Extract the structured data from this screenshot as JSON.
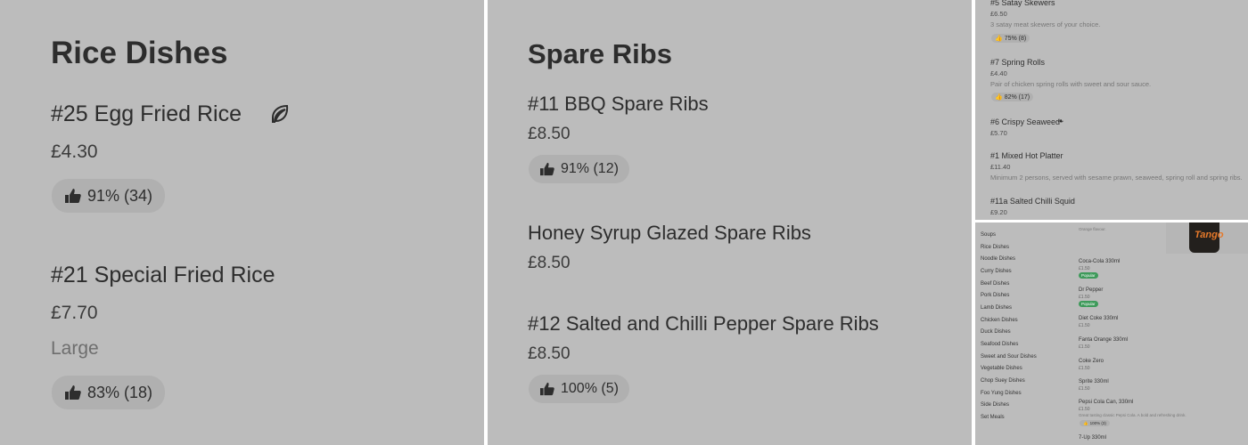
{
  "panel1": {
    "heading": "Rice Dishes",
    "items": [
      {
        "name": "#25 Egg Fried Rice",
        "price": "£4.30",
        "rating": "91% (34)",
        "vegetarian": true
      },
      {
        "name": "#21 Special Fried Rice",
        "price": "£7.70",
        "size": "Large",
        "rating": "83% (18)"
      }
    ]
  },
  "panel2": {
    "heading": "Spare Ribs",
    "items": [
      {
        "name": "#11 BBQ Spare Ribs",
        "price": "£8.50",
        "rating": "91% (12)"
      },
      {
        "name": "Honey Syrup Glazed Spare Ribs",
        "price": "£8.50"
      },
      {
        "name": "#12 Salted and Chilli Pepper Spare Ribs",
        "price": "£8.50",
        "rating": "100% (5)"
      }
    ]
  },
  "panel3": {
    "items": [
      {
        "name": "#5 Satay Skewers",
        "price": "£6.50",
        "desc": "3 satay meat skewers of your choice.",
        "rating": "75% (8)"
      },
      {
        "name": "#7 Spring Rolls",
        "price": "£4.40",
        "desc": "Pair of chicken spring rolls with sweet and sour sauce.",
        "rating": "82% (17)"
      },
      {
        "name": "#6 Crispy Seaweed",
        "price": "£5.70",
        "vegetarian": true
      },
      {
        "name": "#1 Mixed Hot Platter",
        "price": "£11.40",
        "desc": "Minimum 2 persons, served with sesame prawn, seaweed, spring roll and spring ribs."
      },
      {
        "name": "#11a Salted Chilli Squid",
        "price": "£9.20"
      }
    ]
  },
  "panel4": {
    "categories": [
      "Soups",
      "Rice Dishes",
      "Noodle Dishes",
      "Curry Dishes",
      "Beef Dishes",
      "Pork Dishes",
      "Lamb Dishes",
      "Chicken Dishes",
      "Duck Dishes",
      "Seafood Dishes",
      "Sweet and Sour Dishes",
      "Vegetable Dishes",
      "Chop Suey Dishes",
      "Foo Yung Dishes",
      "Side Dishes",
      "Set Meals"
    ],
    "top_desc": "Orange flavour.",
    "product_brand": "Tango",
    "drinks": [
      {
        "name": "Coca-Cola 330ml",
        "price": "£1.50",
        "badge": "Popular"
      },
      {
        "name": "Dr Pepper",
        "price": "£1.50",
        "badge": "Popular"
      },
      {
        "name": "Diet Coke 330ml",
        "price": "£1.50"
      },
      {
        "name": "Fanta Orange 330ml",
        "price": "£1.50"
      },
      {
        "name": "Coke Zero",
        "price": "£1.50"
      },
      {
        "name": "Sprite 330ml",
        "price": "£1.50"
      },
      {
        "name": "Pepsi Cola Can, 330ml",
        "price": "£1.50",
        "desc": "Great tasting classic Pepsi Cola. A bold and refreshing drink.",
        "rating": "100% (3)"
      },
      {
        "name": "7-Up 330ml"
      }
    ]
  },
  "icons": {
    "thumb": "thumbs-up-icon",
    "leaf": "leaf-icon"
  },
  "colors": {
    "background": "#bcbcbc",
    "popular_badge": "#3e9a5a",
    "text": "#2d2d2d"
  }
}
